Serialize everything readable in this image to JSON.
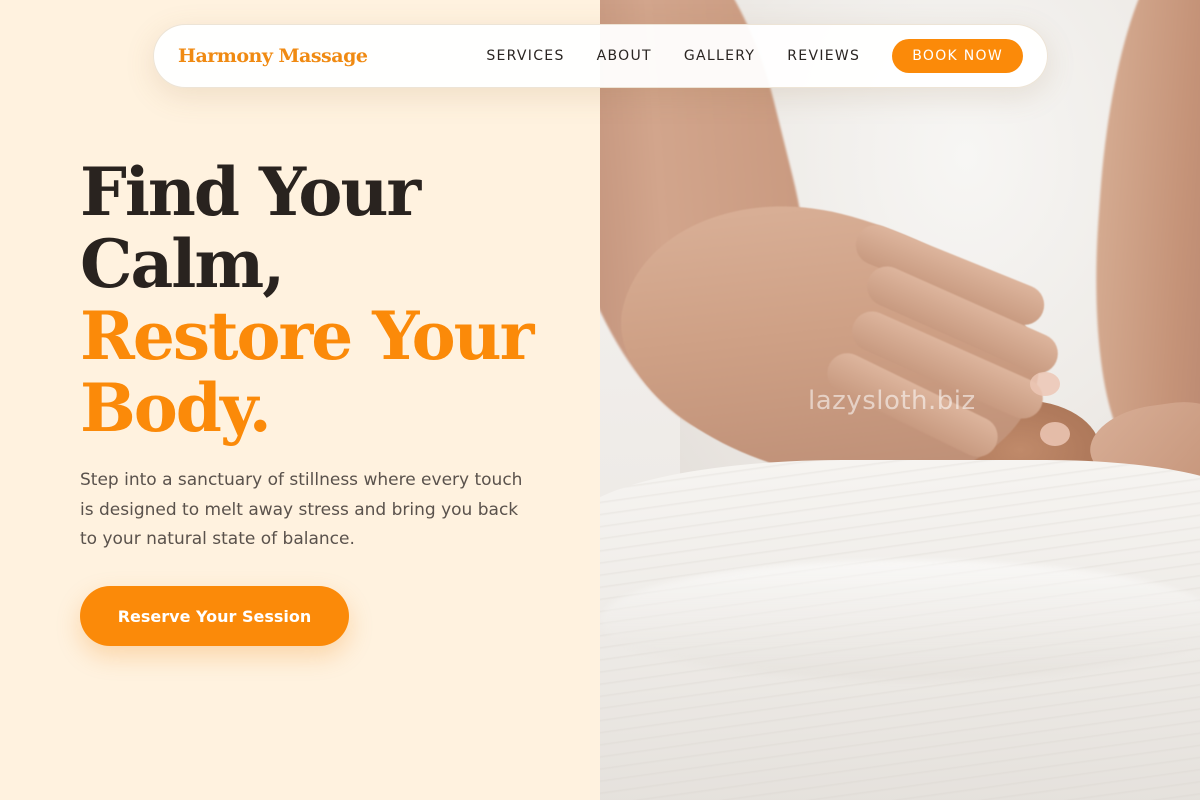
{
  "nav": {
    "brand": "Harmony Massage",
    "links": [
      "SERVICES",
      "ABOUT",
      "GALLERY",
      "REVIEWS"
    ],
    "cta": "BOOK NOW"
  },
  "hero": {
    "title_line1": "Find Your",
    "title_line2": "Calm,",
    "title_accent_line1": "Restore Your",
    "title_accent_line2": "Body.",
    "subtitle": "Step into a sanctuary of stillness where every touch is designed to melt away stress and bring you back to your natural state of balance.",
    "cta": "Reserve Your Session"
  },
  "image": {
    "watermark": "lazysloth.biz"
  },
  "colors": {
    "accent": "#fb8a09",
    "background": "#fff2df",
    "text_dark": "#29231f",
    "text_muted": "#5a524c"
  }
}
